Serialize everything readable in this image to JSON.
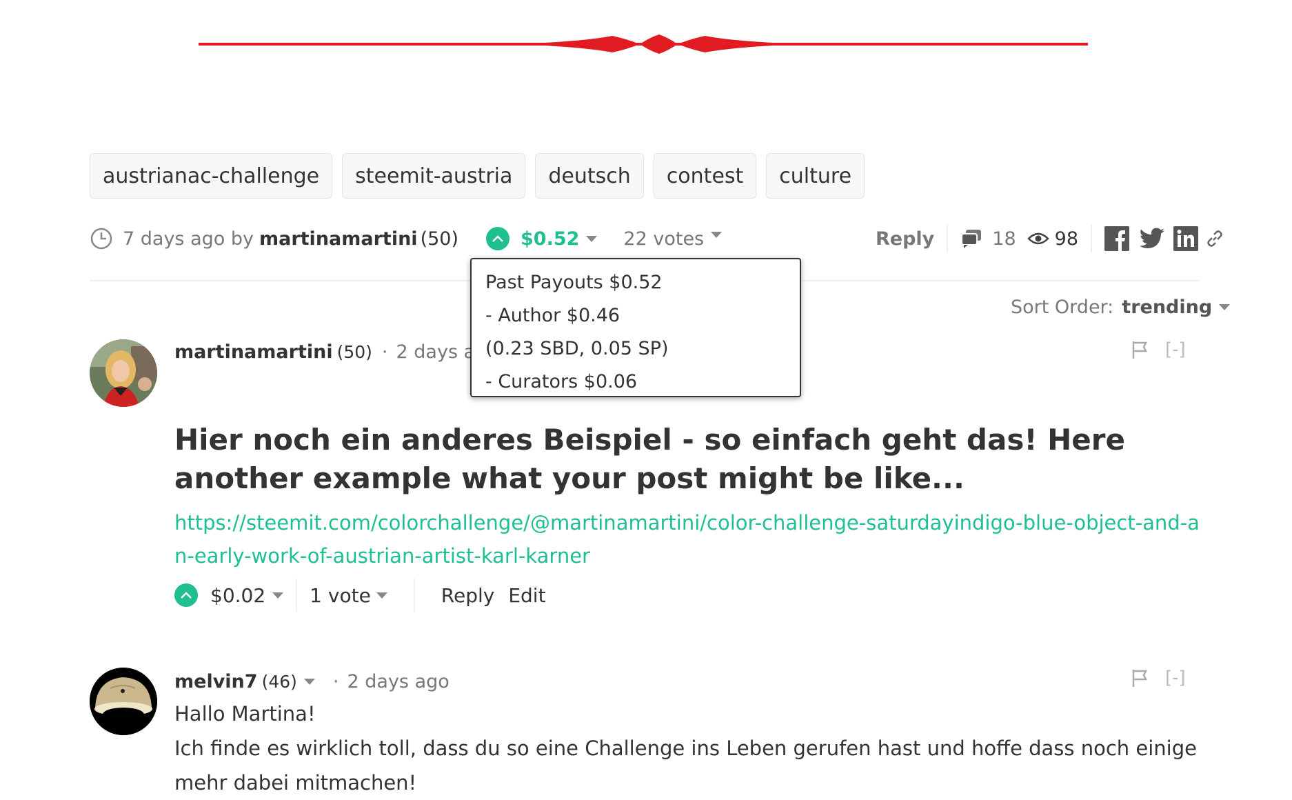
{
  "tags": [
    "austrianac-challenge",
    "steemit-austria",
    "deutsch",
    "contest",
    "culture"
  ],
  "post_meta": {
    "time": "7 days ago by",
    "author": "martinamartini",
    "reputation": "(50)",
    "payout": "$0.52",
    "votes": "22 votes",
    "reply_label": "Reply",
    "comment_count": "18",
    "view_count": "98"
  },
  "payout_tooltip": {
    "line1": "Past Payouts $0.52",
    "line2": "- Author $0.46",
    "line3": "(0.23 SBD, 0.05 SP)",
    "line4": "- Curators $0.06"
  },
  "sort": {
    "label": "Sort Order:",
    "value": "trending"
  },
  "comments": [
    {
      "author": "martinamartini",
      "reputation": "(50)",
      "time": "2 days ago",
      "title": "Hier noch ein anderes Beispiel - so einfach geht das! Here another example what your post might be like...",
      "link": "https://steemit.com/colorchallenge/@martinamartini/color-challenge-saturdayindigo-blue-object-and-an-early-work-of-austrian-artist-karl-karner",
      "payout": "$0.02",
      "votes": "1 vote",
      "reply_label": "Reply",
      "edit_label": "Edit",
      "collapse": "[-]"
    },
    {
      "author": "melvin7",
      "reputation": "(46)",
      "time": "2 days ago",
      "body_line1": "Hallo Martina!",
      "body_line2": "Ich finde es wirklich toll, dass du so eine Challenge ins Leben gerufen hast und hoffe dass noch einige mehr dabei mitmachen!",
      "collapse": "[-]"
    }
  ],
  "colors": {
    "accent": "#1fbf8f",
    "ornament": "#e01b22"
  }
}
